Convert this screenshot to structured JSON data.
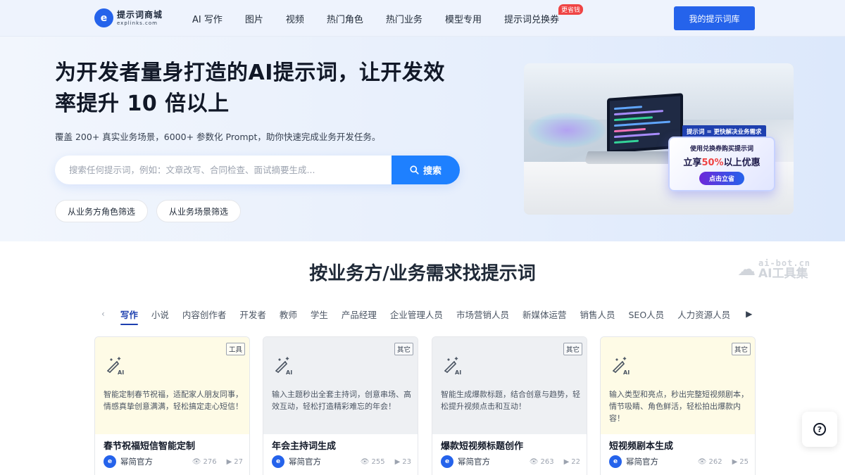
{
  "header": {
    "logo_name": "提示词商城",
    "logo_domain": "explinks.com",
    "logo_mark": "e",
    "nav": [
      {
        "label": "AI 写作"
      },
      {
        "label": "图片"
      },
      {
        "label": "视频"
      },
      {
        "label": "热门角色"
      },
      {
        "label": "热门业务"
      },
      {
        "label": "模型专用"
      },
      {
        "label": "提示词兑换券",
        "badge": "更省钱"
      }
    ],
    "library_button": "我的提示词库"
  },
  "hero": {
    "title": "为开发者量身打造的AI提示词，让开发效率提升 10 倍以上",
    "subtitle": "覆盖 200+ 真实业务场景，6000+ 参数化 Prompt，助你快速完成业务开发任务。",
    "search_placeholder": "搜索任何提示词，例如：文章改写、合同检查、面试摘要生成...",
    "search_button": "搜索",
    "filters": [
      "从业务方角色筛选",
      "从业务场景筛选"
    ],
    "banner": {
      "tag": "提示词 = 更快解决业务需求",
      "line1": "使用兑换券购买提示词",
      "line2_prefix": "立享",
      "line2_pct": "50%",
      "line2_suffix": "以上优惠",
      "cta": "点击立省"
    }
  },
  "section": {
    "title": "按业务方/业务需求找提示词",
    "watermark_top": "ai-bot.cn",
    "watermark_bottom": "AI工具集",
    "tabs": [
      "写作",
      "小说",
      "内容创作者",
      "开发者",
      "教师",
      "学生",
      "产品经理",
      "企业管理人员",
      "市场营销人员",
      "新媒体运营",
      "销售人员",
      "SEO人员",
      "人力资源人员"
    ],
    "active_tab": "写作"
  },
  "cards": [
    {
      "tag": "工具",
      "desc": "智能定制春节祝福，适配家人朋友同事，情感真挚创意满满，轻松搞定走心短信！",
      "title": "春节祝福短信智能定制",
      "author": "幂简官方",
      "views": "276",
      "plays": "27",
      "bg": "#fefbe6"
    },
    {
      "tag": "其它",
      "desc": "输入主题秒出全套主持词，创意串场、高效互动，轻松打造精彩难忘的年会！",
      "title": "年会主持词生成",
      "author": "幂简官方",
      "views": "255",
      "plays": "23",
      "bg": "#eef0f3"
    },
    {
      "tag": "其它",
      "desc": "智能生成爆款标题，结合创意与趋势，轻松提升视频点击和互动！",
      "title": "爆款短视频标题创作",
      "author": "幂简官方",
      "views": "263",
      "plays": "22",
      "bg": "#eef0f3"
    },
    {
      "tag": "其它",
      "desc": "输入类型和亮点，秒出完整短视频剧本，情节吸睛、角色鲜活，轻松拍出爆款内容！",
      "title": "短视频剧本生成",
      "author": "幂简官方",
      "views": "262",
      "plays": "25",
      "bg": "#fefbe6"
    }
  ],
  "help_icon": "question-icon"
}
